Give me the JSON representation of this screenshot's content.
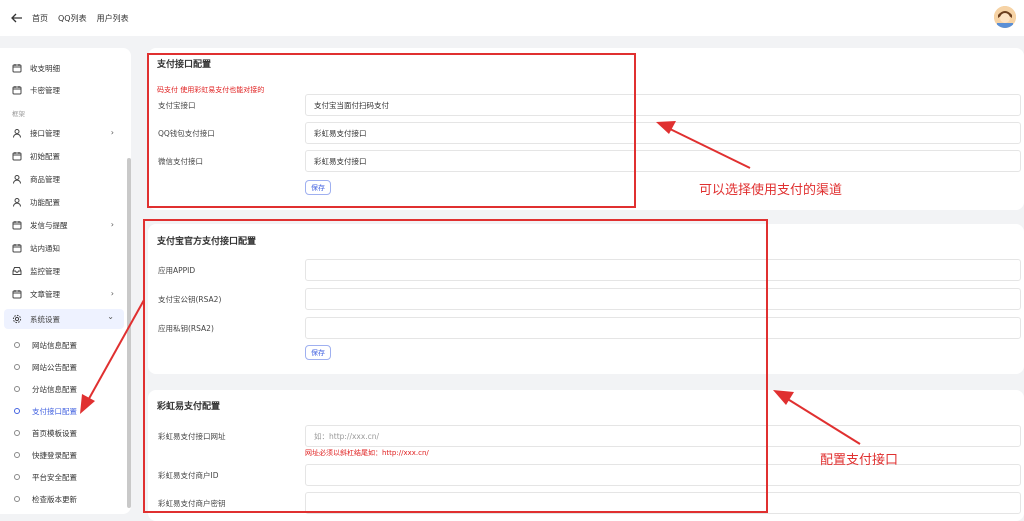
{
  "topbar": {
    "breadcrumbs": [
      "首页",
      "QQ列表",
      "用户列表"
    ]
  },
  "sidebar": {
    "items": [
      {
        "label": "收支明细",
        "icon": "calendar-icon"
      },
      {
        "label": "卡密管理",
        "icon": "calendar-icon"
      }
    ],
    "group_label": "框架",
    "framework_items": [
      {
        "label": "接口管理",
        "icon": "user-icon",
        "chevron": "›"
      },
      {
        "label": "初始配置",
        "icon": "calendar-icon"
      },
      {
        "label": "商品管理",
        "icon": "user-icon"
      },
      {
        "label": "功能配置",
        "icon": "user-icon"
      },
      {
        "label": "发信与提醒",
        "icon": "calendar-icon",
        "chevron": "›"
      },
      {
        "label": "站内通知",
        "icon": "calendar-icon"
      },
      {
        "label": "监控管理",
        "icon": "inbox-icon"
      },
      {
        "label": "文章管理",
        "icon": "calendar-icon",
        "chevron": "›"
      },
      {
        "label": "系统设置",
        "icon": "gear-icon",
        "chevron": "⌄"
      }
    ],
    "sub_items": [
      "网站信息配置",
      "网站公告配置",
      "分站信息配置",
      "支付接口配置",
      "首页模板设置",
      "快捷登录配置",
      "平台安全配置",
      "检查版本更新"
    ],
    "active_sub": "支付接口配置"
  },
  "payment_config": {
    "title": "支付接口配置",
    "note": "码支付 使用彩虹易支付也能对接的",
    "rows": [
      {
        "label": "支付宝接口",
        "value": "支付宝当面付扫码支付"
      },
      {
        "label": "QQ钱包支付接口",
        "value": "彩虹易支付接口"
      },
      {
        "label": "微信支付接口",
        "value": "彩虹易支付接口"
      }
    ],
    "save_label": "保存"
  },
  "alipay_config": {
    "title": "支付宝官方支付接口配置",
    "rows": [
      {
        "label": "应用APPID",
        "value": ""
      },
      {
        "label": "支付宝公钥(RSA2)",
        "value": ""
      },
      {
        "label": "应用私钥(RSA2)",
        "value": ""
      }
    ],
    "save_label": "保存"
  },
  "rainbow_config": {
    "title": "彩虹易支付配置",
    "rows": [
      {
        "label": "彩虹易支付接口网址",
        "placeholder": "如：http://xxx.cn/"
      },
      {
        "label": "彩虹易支付商户ID",
        "value": ""
      },
      {
        "label": "彩虹易支付商户密钥",
        "value": ""
      }
    ],
    "url_note": "网址必须以斜杠结尾如：http://xxx.cn/"
  },
  "annotations": {
    "channel_text": "可以选择使用支付的渠道",
    "config_text": "配置支付接口",
    "color": "#e03030"
  }
}
